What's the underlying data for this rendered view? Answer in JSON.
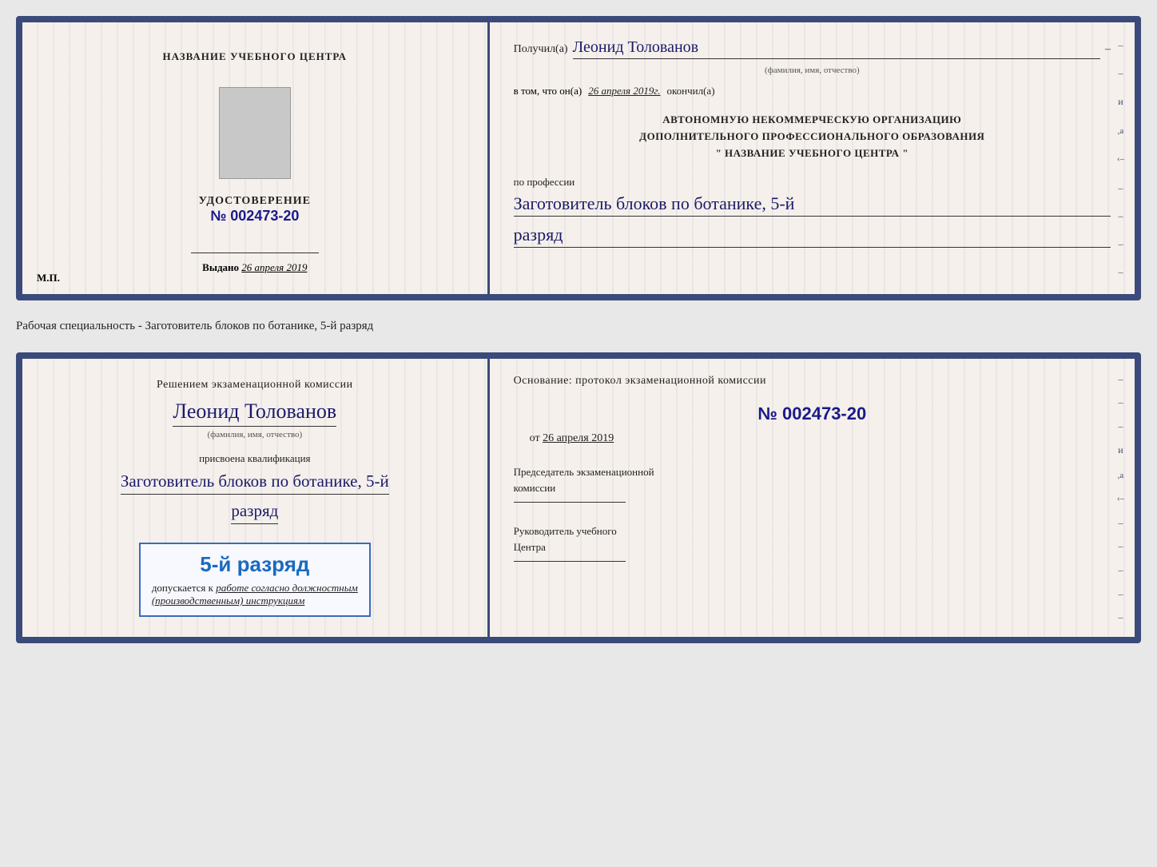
{
  "card1": {
    "left": {
      "center_title": "НАЗВАНИЕ УЧЕБНОГО ЦЕНТРА",
      "udostoverenie_label": "УДОСТОВЕРЕНИЕ",
      "number": "№ 002473-20",
      "vydano_label": "Выдано",
      "vydano_date": "26 апреля 2019",
      "mp_label": "М.П."
    },
    "right": {
      "received_label": "Получил(а)",
      "received_name": "Леонид Толованов",
      "received_dash": "–",
      "fio_label": "(фамилия, имя, отчество)",
      "vtom_prefix": "в том, что он(а)",
      "vtom_date": "26 апреля 2019г.",
      "vtom_end": "окончил(а)",
      "avtonomnuyu_line1": "АВТОНОМНУЮ НЕКОММЕРЧЕСКУЮ ОРГАНИЗАЦИЮ",
      "avtonomnuyu_line2": "ДОПОЛНИТЕЛЬНОГО ПРОФЕССИОНАЛЬНОГО ОБРАЗОВАНИЯ",
      "avtonomnuyu_line3": "\"  НАЗВАНИЕ УЧЕБНОГО ЦЕНТРА  \"",
      "po_professii_label": "по профессии",
      "profession_name": "Заготовитель блоков по ботанике, 5-й",
      "razryad_name": "разряд"
    }
  },
  "middle_label": "Рабочая специальность - Заготовитель блоков по ботанике, 5-й разряд",
  "card2": {
    "left": {
      "resheniem_label": "Решением экзаменационной комиссии",
      "person_name": "Леонид Толованов",
      "fio_label": "(фамилия, имя, отчество)",
      "prisvoena_label": "присвоена квалификация",
      "profession_name": "Заготовитель блоков по ботанике, 5-й",
      "razryad_name": "разряд",
      "blue_box_title": "5-й разряд",
      "blue_box_text_prefix": "допускается к",
      "blue_box_italic": "работе согласно должностным",
      "blue_box_italic2": "(производственным) инструкциям"
    },
    "right": {
      "osnovanie_label": "Основание: протокол экзаменационной комиссии",
      "protokol_number": "№  002473-20",
      "ot_prefix": "от",
      "ot_date": "26 апреля 2019",
      "predsedatel_line1": "Председатель экзаменационной",
      "predsedatel_line2": "комиссии",
      "rukovoditel_line1": "Руководитель учебного",
      "rukovoditel_line2": "Центра"
    }
  },
  "side_marks": {
    "dashes": [
      "–",
      "–",
      "–",
      "–",
      "–",
      "–",
      "–",
      "–",
      "–"
    ],
    "i_text": "и",
    "a_text": ",а",
    "arrow_text": "‹–"
  }
}
